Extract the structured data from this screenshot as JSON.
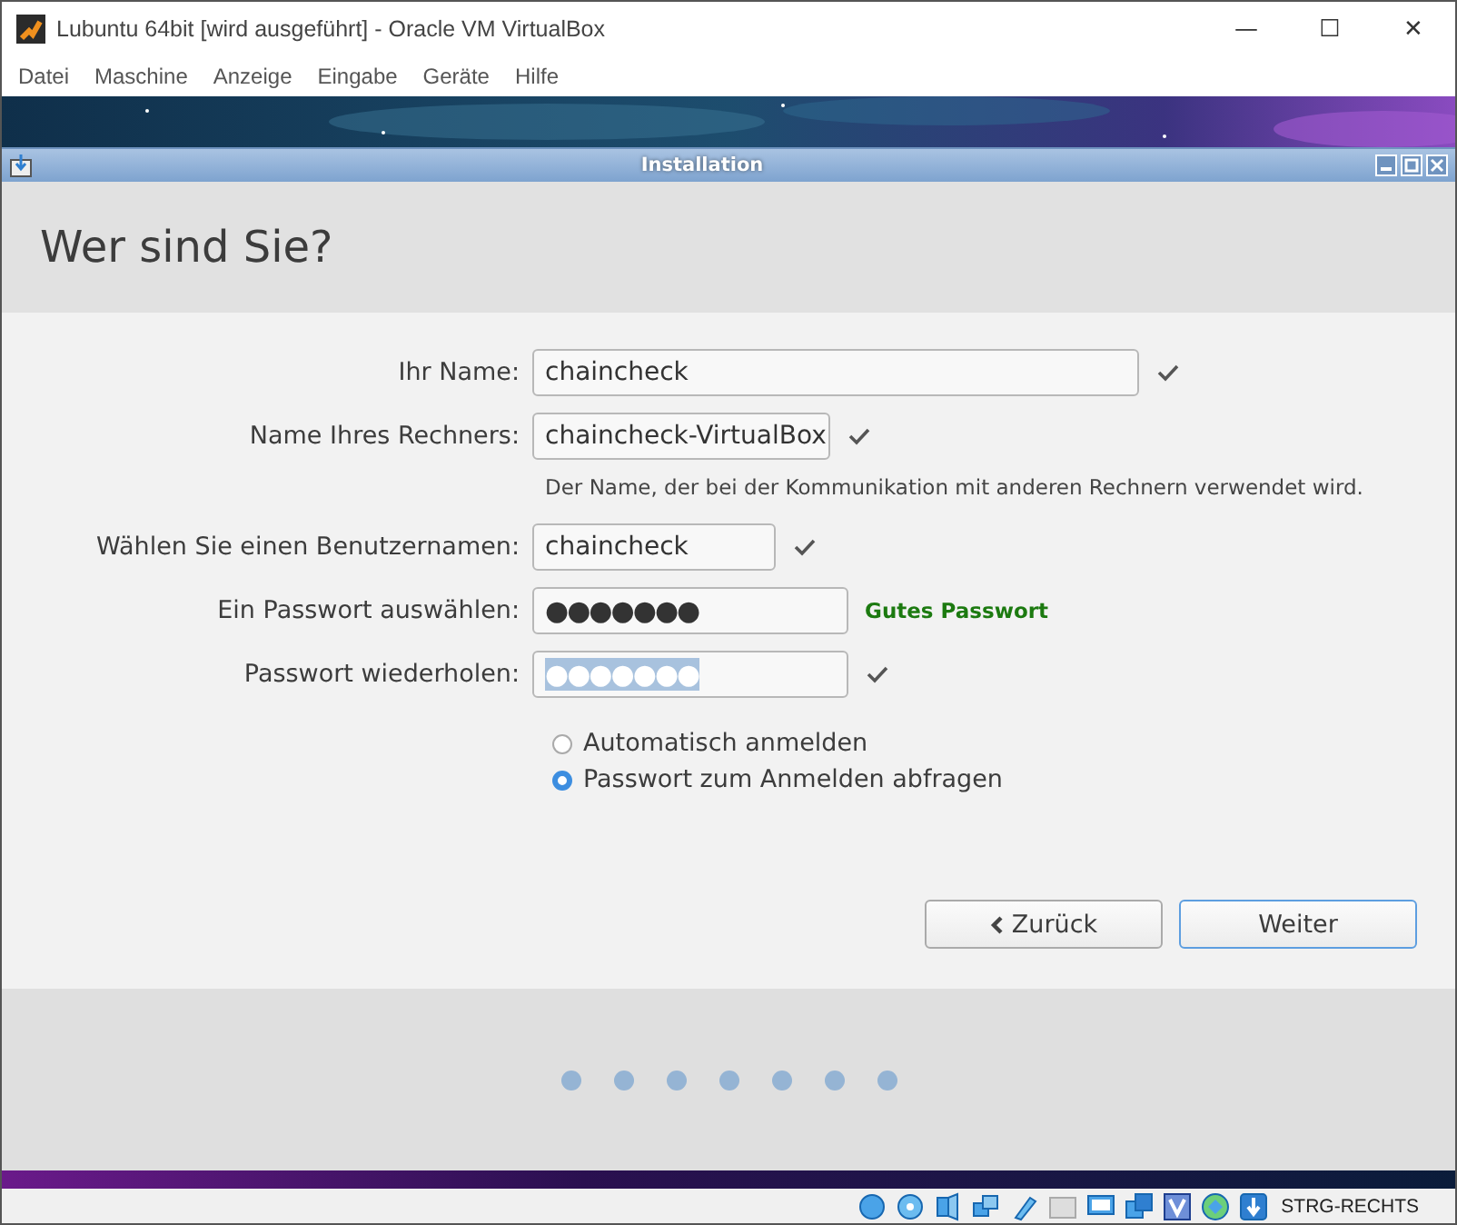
{
  "window": {
    "title": "Lubuntu 64bit [wird ausgeführt] - Oracle VM VirtualBox",
    "minimize": "—",
    "maximize": "☐",
    "close": "✕"
  },
  "menu": [
    "Datei",
    "Maschine",
    "Anzeige",
    "Eingabe",
    "Geräte",
    "Hilfe"
  ],
  "installer": {
    "title": "Installation",
    "heading": "Wer sind Sie?",
    "fields": [
      {
        "label": "Ihr Name:",
        "value": "chaincheck",
        "valid": true,
        "selected_text": false
      },
      {
        "label": "Name Ihres Rechners:",
        "value": "chaincheck-VirtualBox",
        "valid": true,
        "selected_text": false,
        "hint": "Der Name, der bei der Kommunikation mit anderen Rechnern verwendet wird."
      },
      {
        "label": "Wählen Sie einen Benutzernamen:",
        "value": "chaincheck",
        "valid": true,
        "selected_text": false
      },
      {
        "label": "Ein Passwort auswählen:",
        "value": "●●●●●●●",
        "valid": false,
        "selected_text": false,
        "strength": "Gutes Passwort"
      },
      {
        "label": "Passwort wiederholen:",
        "value": "●●●●●●●",
        "valid": true,
        "selected_text": true
      }
    ],
    "options": [
      {
        "label": "Automatisch anmelden",
        "selected": false
      },
      {
        "label": "Passwort zum Anmelden abfragen",
        "selected": true
      }
    ],
    "buttons": [
      {
        "label": "Zurück",
        "kind": "back",
        "focused": false
      },
      {
        "label": "Weiter",
        "kind": "next",
        "focused": true
      }
    ],
    "progress": [
      {
        "selected": false
      },
      {
        "selected": false
      },
      {
        "selected": false
      },
      {
        "selected": false
      },
      {
        "selected": false
      },
      {
        "selected": false
      },
      {
        "selected": false
      }
    ]
  },
  "status_bar": {
    "host_key": "STRG-RECHTS"
  }
}
